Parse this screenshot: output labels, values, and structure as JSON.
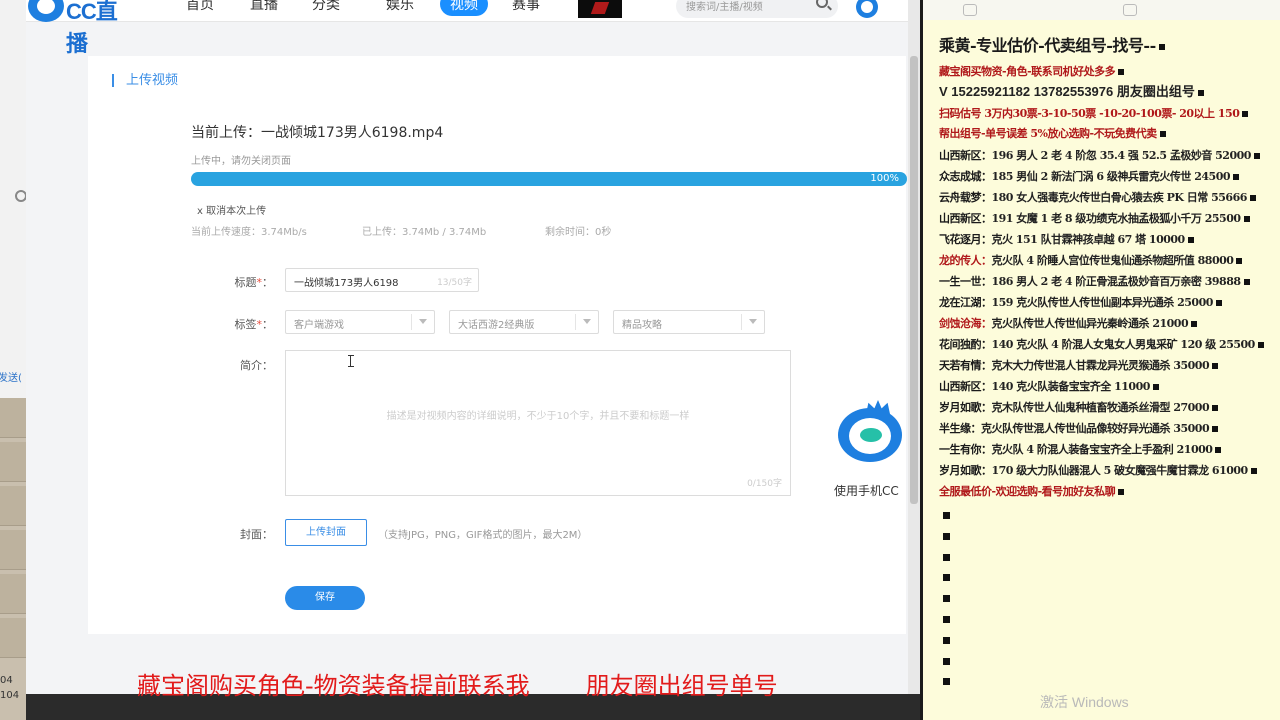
{
  "nav": {
    "logo_text": "CC直播",
    "items": [
      "首页",
      "直播",
      "分类",
      "娱乐",
      "视频",
      "赛事"
    ],
    "search_placeholder": "搜索词/主播/视频"
  },
  "upload": {
    "panel_title": "上传视频",
    "current_upload": "当前上传：一战倾城173男人6198.mp4",
    "note": "上传中，请勿关闭页面",
    "progress_pct": "100%",
    "progress_value": 1.0,
    "cancel_label": "x 取消本次上传",
    "speed": "当前上传速度：3.74Mb/s",
    "uploaded": "已上传：3.74Mb / 3.74Mb",
    "remaining": "剩余时间：0秒"
  },
  "form": {
    "title_label": "标题",
    "title_value": "一战倾城173男人6198",
    "title_count": "13/50字",
    "tags_label": "标签",
    "tag1": "客户端游戏",
    "tag2": "大话西游2经典版",
    "tag3": "精品攻略",
    "desc_label": "简介：",
    "desc_placeholder": "描述是对视频内容的详细说明，不少于10个字，并且不要和标题一样",
    "desc_count": "0/150字",
    "cover_label": "封面：",
    "cover_button": "上传封面",
    "cover_hint": "（支持JPG，PNG，GIF格式的图片，最大2M）",
    "save_button": "保存",
    "required_mark": "*",
    "colon": "："
  },
  "mobile": {
    "text": "使用手机CC"
  },
  "left_strip": {
    "send": "发送(",
    "num1": "04",
    "num2": "104"
  },
  "ad": {
    "title": "乘黄-专业估价-代卖组号-找号--",
    "lines": [
      {
        "text": "藏宝阁买物资-角色-联系司机好处多多",
        "red": true
      },
      {
        "text": "V 15225921182   13782553976 朋友圈出组号",
        "phone": true
      },
      {
        "text": "扫码估号 3万内30票-3-10-50票  -10-20-100票- 20以上 150",
        "red": true
      },
      {
        "text": "帮出组号-单号误差 5%放心选购-不玩免费代卖",
        "red": true
      },
      {
        "zone": "山西新区：",
        "text": "196 男人 2 老 4 阶忽 35.4 强 52.5 孟极妙音 52000"
      },
      {
        "zone": "众志成城：",
        "text": "185 男仙 2 新法门涡 6 级神兵雷克火传世 24500"
      },
      {
        "zone": "云舟载梦：",
        "text": "180 女人强毒克火传世白骨心猿去疾 PK 日常 55666"
      },
      {
        "zone": "山西新区：",
        "text": "191 女魔 1 老 8 级功绩克水抽孟极狐小千万 25500"
      },
      {
        "zone": "飞花逐月：",
        "text": "克火 151 队甘霖神孩卓越 67 塔 10000"
      },
      {
        "zone": "龙的传人：",
        "text": "克火队 4 阶睡人宫位传世鬼仙通杀物超所值 88000",
        "zone_red": true
      },
      {
        "zone": "一生一世：",
        "text": "186 男人 2 老 4 阶正骨混孟极妙音百万亲密 39888"
      },
      {
        "zone": "龙在江湖：",
        "text": "159 克火队传世人传世仙副本异光通杀 25000"
      },
      {
        "zone": "剑蚀沧海：",
        "text": "克火队传世人传世仙异光秦岭通杀 21000",
        "zone_red": true
      },
      {
        "zone": "花间独酌：",
        "text": "140 克火队 4 阶混人女鬼女人男鬼采矿 120 级 25500"
      },
      {
        "zone": "天若有情：",
        "text": "克木大力传世混人甘霖龙异光灵猴通杀 35000"
      },
      {
        "zone": "山西新区：",
        "text": "140 克火队装备宝宝齐全 11000"
      },
      {
        "zone": "岁月如歌：",
        "text": "克木队传世人仙鬼种植畜牧通杀丝滑型 27000"
      },
      {
        "zone": "半生缘：",
        "text": "克火队传世混人传世仙品像较好异光通杀 35000"
      },
      {
        "zone": "一生有你：",
        "text": "克火队 4 阶混人装备宝宝齐全上手盈利 21000"
      },
      {
        "zone": "岁月如歌：",
        "text": "170 级大力队仙器混人 5 破女魔强牛魔甘霖龙 61000"
      },
      {
        "text": "全服最低价-欢迎选购-看号加好友私聊",
        "red": true
      }
    ]
  },
  "overlay": {
    "left": "藏宝阁购买角色-物资装备提前联系我",
    "right": "朋友圈出组号单号"
  },
  "watermark": "激活 Windows",
  "colors": {
    "accent": "#2a8be8",
    "progress": "#29a3e0",
    "overlay_red": "#e21b1b",
    "ad_bg": "#fdfcdb"
  }
}
